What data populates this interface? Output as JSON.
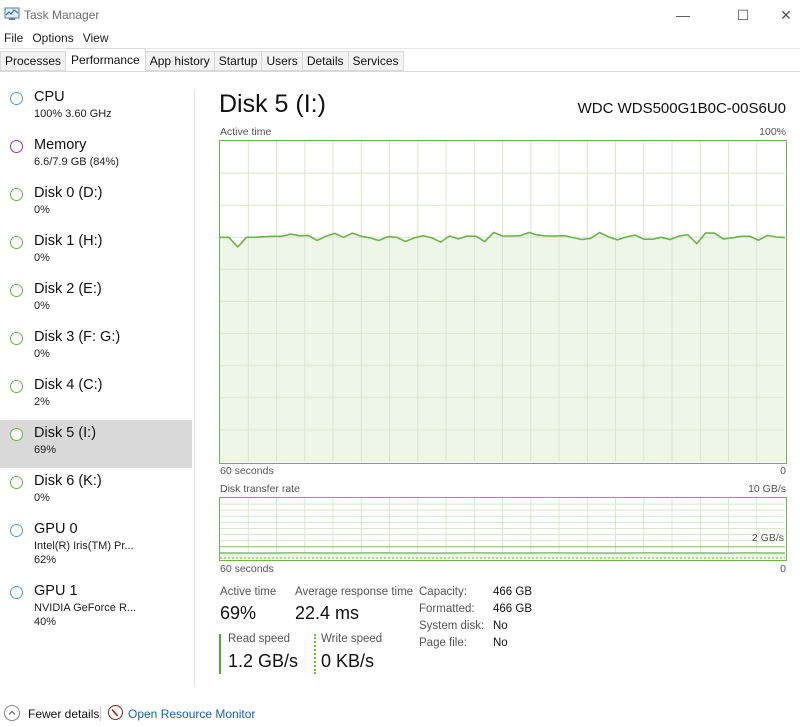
{
  "window": {
    "title": "Task Manager",
    "controls": {
      "minimize": "—",
      "maximize": "☐",
      "close": "✕"
    }
  },
  "menu": [
    "File",
    "Options",
    "View"
  ],
  "tabs": [
    {
      "label": "Processes",
      "active": false
    },
    {
      "label": "Performance",
      "active": true
    },
    {
      "label": "App history",
      "active": false
    },
    {
      "label": "Startup",
      "active": false
    },
    {
      "label": "Users",
      "active": false
    },
    {
      "label": "Details",
      "active": false
    },
    {
      "label": "Services",
      "active": false
    }
  ],
  "sidebar": {
    "items": [
      {
        "title": "CPU",
        "sub": "100% 3.60 GHz",
        "color": "#4f9fd3",
        "selected": false
      },
      {
        "title": "Memory",
        "sub": "6.6/7.9 GB (84%)",
        "color": "#9b35b6",
        "selected": false
      },
      {
        "title": "Disk 0 (D:)",
        "sub": "0%",
        "color": "#6cb348",
        "selected": false
      },
      {
        "title": "Disk 1 (H:)",
        "sub": "0%",
        "color": "#6cb348",
        "selected": false
      },
      {
        "title": "Disk 2 (E:)",
        "sub": "0%",
        "color": "#6cb348",
        "selected": false
      },
      {
        "title": "Disk 3 (F: G:)",
        "sub": "0%",
        "color": "#6cb348",
        "selected": false
      },
      {
        "title": "Disk 4 (C:)",
        "sub": "2%",
        "color": "#6cb348",
        "selected": false
      },
      {
        "title": "Disk 5 (I:)",
        "sub": "69%",
        "color": "#6cb348",
        "selected": true
      },
      {
        "title": "Disk 6 (K:)",
        "sub": "0%",
        "color": "#6cb348",
        "selected": false
      },
      {
        "title": "GPU 0",
        "sub": "Intel(R) Iris(TM) Pr...",
        "sub2": "62%",
        "color": "#4f9fd3",
        "selected": false
      },
      {
        "title": "GPU 1",
        "sub": "NVIDIA GeForce R...",
        "sub2": "40%",
        "color": "#4f9fd3",
        "selected": false
      }
    ]
  },
  "main": {
    "title": "Disk 5 (I:)",
    "device": "WDC WDS500G1B0C-00S6U0",
    "active_graph": {
      "label": "Active time",
      "max_label": "100%",
      "time_label": "60 seconds",
      "min_label": "0"
    },
    "transfer_graph": {
      "label": "Disk transfer rate",
      "max_label": "10 GB/s",
      "mid_label": "2 GB/s",
      "time_label": "60 seconds",
      "min_label": "0"
    },
    "stats": {
      "active_time_label": "Active time",
      "active_time_value": "69%",
      "avg_response_label": "Average response time",
      "avg_response_value": "22.4 ms",
      "read_label": "Read speed",
      "read_value": "1.2 GB/s",
      "write_label": "Write speed",
      "write_value": "0 KB/s"
    },
    "properties": [
      {
        "label": "Capacity:",
        "value": "466 GB"
      },
      {
        "label": "Formatted:",
        "value": "466 GB"
      },
      {
        "label": "System disk:",
        "value": "No"
      },
      {
        "label": "Page file:",
        "value": "No"
      }
    ]
  },
  "footer": {
    "fewer_details": "Fewer details",
    "open_resource_monitor": "Open Resource Monitor"
  },
  "colors": {
    "disk_line": "#6eb34d",
    "disk_fill": "#eef6e8",
    "grid": "#d8e8cf",
    "selected_bg": "#d9d9d9",
    "link": "#1a5fb4"
  },
  "chart_data": [
    {
      "type": "area",
      "title": "Active time",
      "xlabel": "60 seconds",
      "ylim": [
        0,
        100
      ],
      "y_unit": "%",
      "grid": true,
      "series": [
        {
          "name": "Active time",
          "values": [
            70,
            70,
            67,
            70,
            70,
            70.2,
            70.3,
            70.3,
            71,
            70.5,
            70.6,
            69,
            70.3,
            71.2,
            70,
            71.3,
            70.3,
            69.8,
            69,
            70.2,
            70,
            68.7,
            69.8,
            70.5,
            69.8,
            68.5,
            70.4,
            69.5,
            70.4,
            70.3,
            68.7,
            71.5,
            70.4,
            70.4,
            70.5,
            71.5,
            70.7,
            70.4,
            70.4,
            70.5,
            69.9,
            69.3,
            69.7,
            71.5,
            70.2,
            69.2,
            70.1,
            70.7,
            69.4,
            69.4,
            70,
            69.3,
            70.4,
            70.8,
            68,
            71.3,
            71.3,
            69.5,
            69.8,
            70.3,
            70.3,
            69.1,
            70.6,
            70.1,
            69.9
          ]
        }
      ]
    },
    {
      "type": "area",
      "title": "Disk transfer rate",
      "xlabel": "60 seconds",
      "ylim": [
        0,
        10
      ],
      "y_unit": "GB/s",
      "annotations": [
        "10 GB/s",
        "2 GB/s"
      ],
      "grid": true,
      "series": [
        {
          "name": "Read",
          "values": [
            1.2,
            1.2,
            1.15,
            1.2,
            1.25,
            1.2,
            1.2,
            1.2,
            1.25,
            1.2,
            1.2,
            1.15,
            1.2,
            1.25,
            1.2,
            1.2,
            1.2,
            1.25,
            1.2,
            1.2,
            1.15,
            1.2,
            1.25,
            1.2,
            1.2,
            1.2,
            1.15,
            1.25,
            1.2,
            1.2
          ]
        },
        {
          "name": "Write",
          "values": [
            0,
            0,
            0,
            0,
            0,
            0,
            0,
            0,
            0,
            0,
            0,
            0,
            0,
            0,
            0,
            0,
            0,
            0,
            0,
            0,
            0,
            0,
            0,
            0,
            0,
            0,
            0,
            0,
            0,
            0
          ]
        }
      ]
    }
  ]
}
